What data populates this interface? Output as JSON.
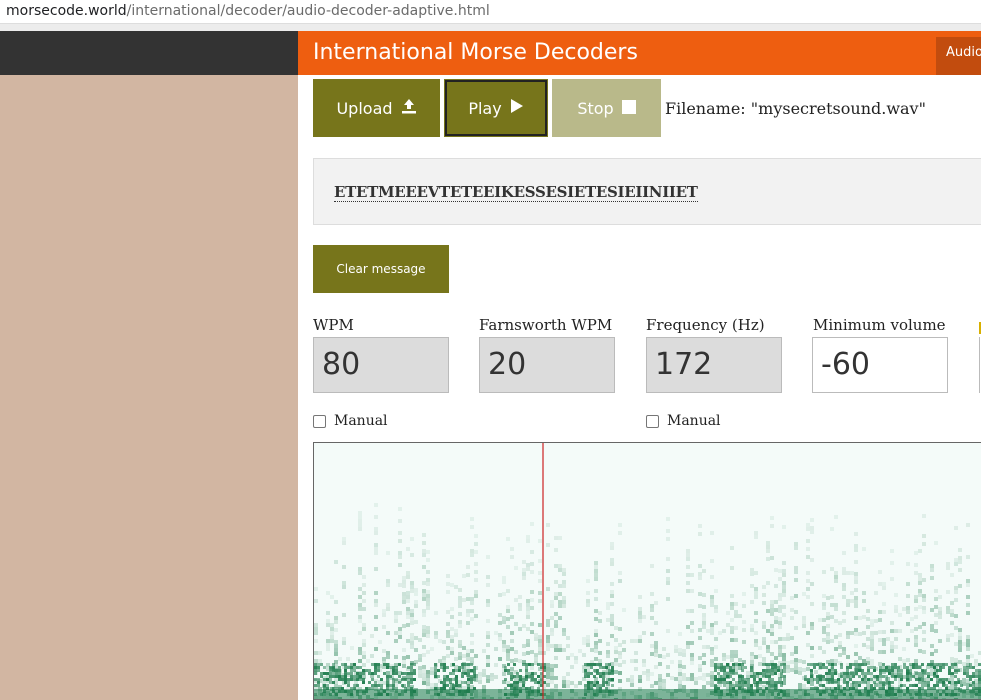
{
  "browser": {
    "url_host": "morsecode.world",
    "url_path": "/international/decoder/audio-decoder-adaptive.html"
  },
  "header": {
    "title": "International Morse Decoders",
    "tab_label": "Audio"
  },
  "controls": {
    "upload_label": "Upload",
    "play_label": "Play",
    "stop_label": "Stop",
    "filename_label": "Filename:",
    "filename_value": "\"mysecretsound.wav\""
  },
  "decoded_message": "ETETMEEEVTETEEIKESSESIETESIEIINIIET",
  "clear_label": "Clear message",
  "fields": {
    "wpm": {
      "label": "WPM",
      "value": "80"
    },
    "farnsworth": {
      "label": "Farnsworth WPM",
      "value": "20"
    },
    "frequency": {
      "label": "Frequency (Hz)",
      "value": "172"
    },
    "min_volume": {
      "label": "Minimum volume",
      "value": "-60"
    }
  },
  "manual_label": "Manual",
  "colors": {
    "accent_orange": "#ee5e10",
    "button_olive": "#77751b",
    "button_disabled": "#b9b98a",
    "spectrogram_green": "#1a7a4a",
    "playhead_red": "#cc2222"
  },
  "icons": {
    "upload": "upload-arrow-icon",
    "play": "play-triangle-icon",
    "stop": "stop-square-icon"
  }
}
